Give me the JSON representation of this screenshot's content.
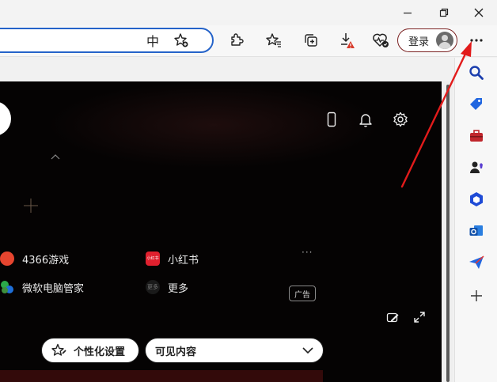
{
  "window": {
    "minimize_icon": "minimize-icon",
    "restore_icon": "restore-icon",
    "close_icon": "close-icon"
  },
  "toolbar": {
    "reader_mode_glyph": "中",
    "login_label": "登录",
    "icons": [
      "reader-mode-icon",
      "add-favorite-icon",
      "extensions-icon",
      "favorites-icon",
      "collections-icon",
      "downloads-icon",
      "browser-essentials-icon",
      "settings-more-icon"
    ]
  },
  "newtab": {
    "quick_links": [
      {
        "label": "4366游戏",
        "icon": "tile-4366-icon"
      },
      {
        "label": "小红书",
        "icon": "tile-xhs-icon",
        "icon_text": "小红书"
      },
      {
        "label": "微软电脑管家",
        "icon": "tile-pcmgr-icon"
      },
      {
        "label": "更多",
        "icon": "tile-more-icon",
        "icon_text": "更多"
      }
    ],
    "more_dots": "···",
    "ad_badge": "广告"
  },
  "controls": {
    "personalize_label": "个性化设置",
    "visible_content_label": "可见内容"
  },
  "sidebar": {
    "icons": [
      "search-icon",
      "shopping-tag-icon",
      "tools-icon",
      "games-icon",
      "microsoft-365-icon",
      "outlook-icon",
      "drop-icon",
      "add-icon"
    ]
  },
  "colors": {
    "accent_blue": "#2563c9",
    "arrow_red": "#e21b1b",
    "dark_bg": "#050303"
  }
}
